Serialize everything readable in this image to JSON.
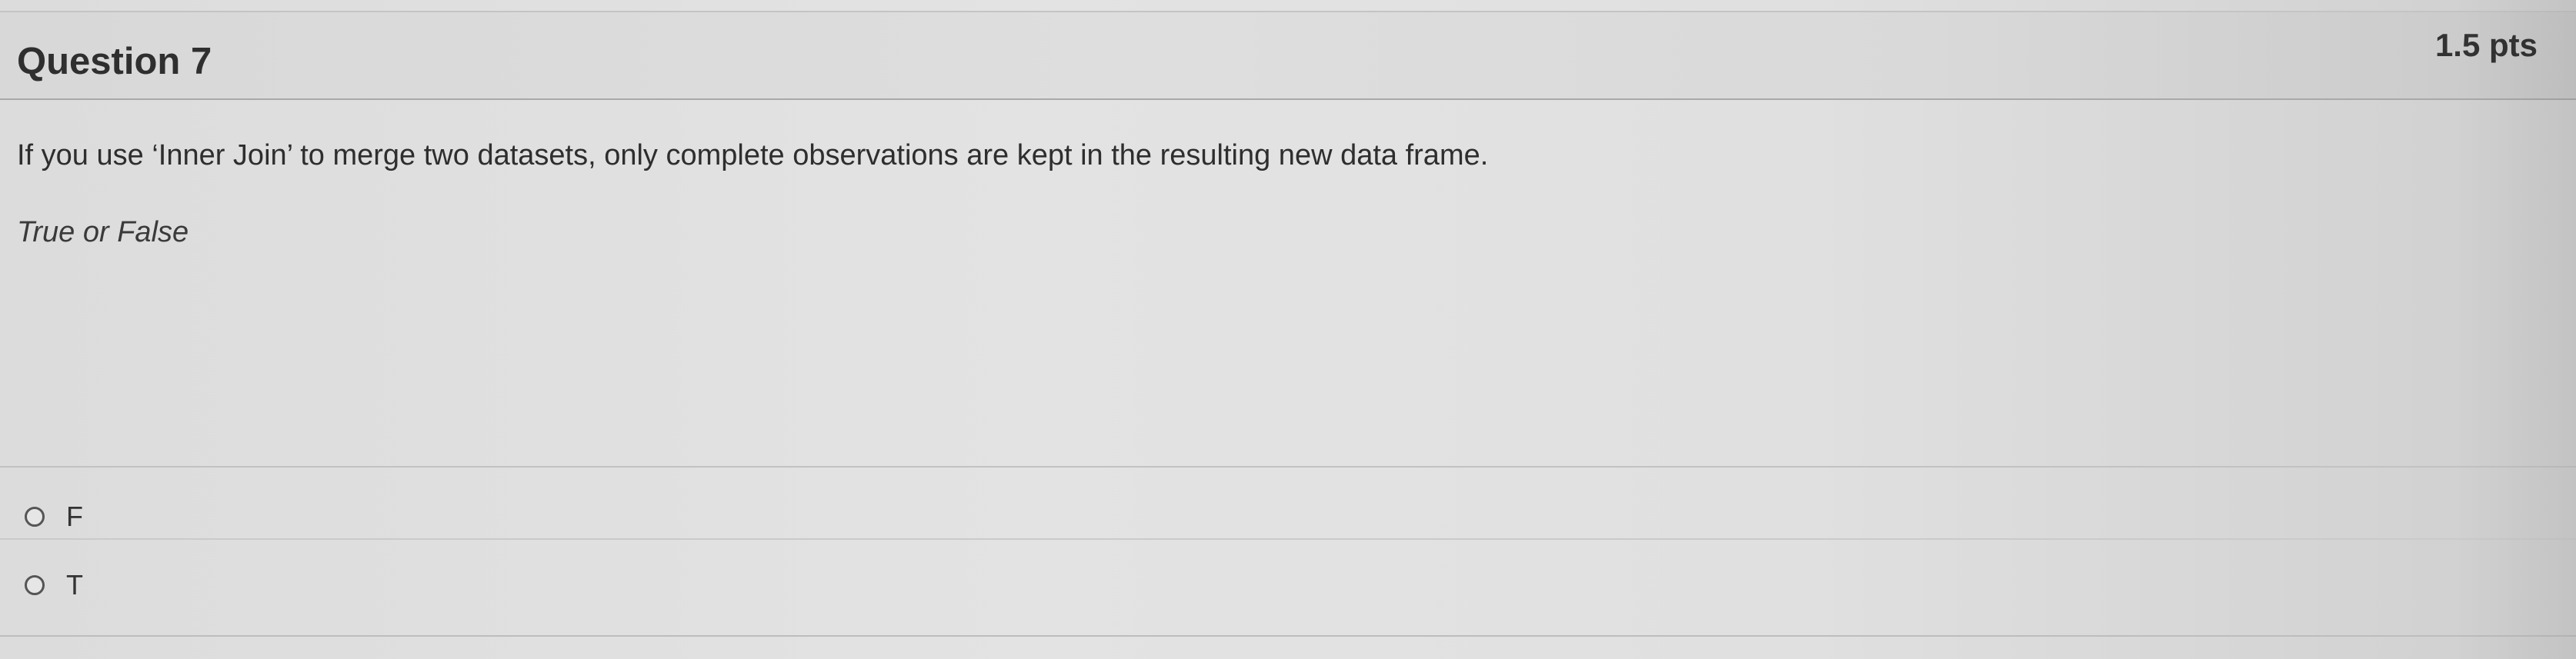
{
  "question": {
    "title": "Question 7",
    "points": "1.5 pts",
    "text": "If you use ‘Inner Join’ to merge two datasets, only complete observations are kept in the resulting new data frame.",
    "hint": "True or False",
    "answers": [
      {
        "label": "F",
        "selected": false
      },
      {
        "label": "T",
        "selected": false
      }
    ]
  }
}
